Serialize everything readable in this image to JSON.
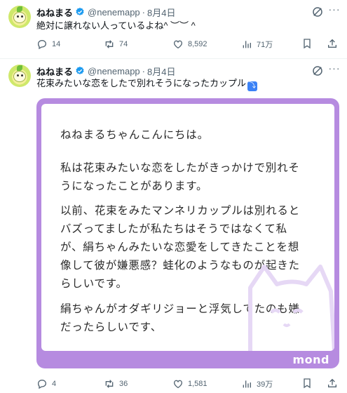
{
  "tweets": [
    {
      "name": "ねねまる",
      "handle": "@nenemapp",
      "date": "8月4日",
      "text": "絶対に譲れない人っているよね^ ︶︶ ^",
      "actions": {
        "replies": "14",
        "reposts": "74",
        "likes": "8,592",
        "views": "71万"
      }
    },
    {
      "name": "ねねまる",
      "handle": "@nenemapp",
      "date": "8月4日",
      "text": "花束みたいな恋をしたで別れそうになったカップル",
      "actions": {
        "replies": "4",
        "reposts": "36",
        "likes": "1,581",
        "views": "39万"
      },
      "card": {
        "lines": [
          "ねねまるちゃんこんにちは。",
          "私は花束みたいな恋をしたがきっかけで別れそ",
          "うになったことがあります。",
          "以前、花束をみたマンネリカップルは別れると",
          "バズってましたが私たちはそうではなくて私",
          "が、絹ちゃんみたいな恋愛をしてきたことを想",
          "像して彼が嫌悪感？蛙化のようなものが起きた",
          "らしいです。",
          "絹ちゃんがオダギリジョーと浮気してたのも嫌",
          "だったらしいです、"
        ],
        "watermark": "mond"
      }
    }
  ],
  "icons": {
    "verified": "verified-badge-icon",
    "grok": "grok-icon",
    "more": "more-icon",
    "reply": "reply-icon",
    "repost": "repost-icon",
    "like": "like-icon",
    "views": "views-icon",
    "bookmark": "bookmark-icon",
    "share": "share-icon"
  },
  "colors": {
    "accent": "#1d9bf0",
    "secondary_text": "#536471",
    "card_frame": "#b68be0"
  }
}
